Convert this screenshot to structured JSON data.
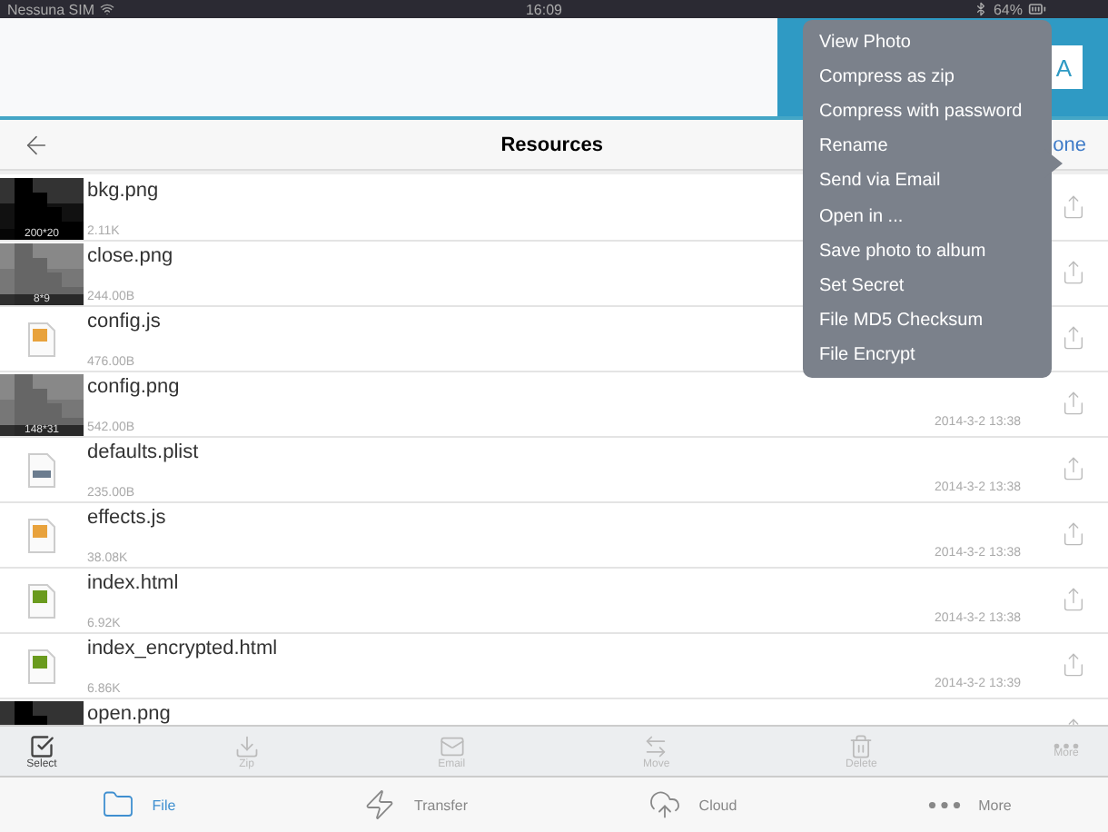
{
  "status_bar": {
    "carrier": "Nessuna SIM",
    "time": "16:09",
    "battery": "64%"
  },
  "header": {
    "button": "A"
  },
  "nav": {
    "title": "Resources",
    "action": "one"
  },
  "files": [
    {
      "name": "bkg.png",
      "size": "2.11K",
      "dims": "200*20"
    },
    {
      "name": "close.png",
      "size": "244.00B",
      "dims": "8*9"
    },
    {
      "name": "config.js",
      "size": "476.00B",
      "kind": "js"
    },
    {
      "name": "config.png",
      "size": "542.00B",
      "dims": "148*31",
      "date": "2014-3-2 13:38"
    },
    {
      "name": "defaults.plist",
      "size": "235.00B",
      "kind": "plist",
      "date": "2014-3-2 13:38"
    },
    {
      "name": "effects.js",
      "size": "38.08K",
      "kind": "js",
      "date": "2014-3-2 13:38"
    },
    {
      "name": "index.html",
      "size": "6.92K",
      "kind": "html",
      "date": "2014-3-2 13:38"
    },
    {
      "name": "index_encrypted.html",
      "size": "6.86K",
      "kind": "html",
      "date": "2014-3-2 13:39"
    },
    {
      "name": "open.png"
    }
  ],
  "toolbar": [
    {
      "label": "Select",
      "kind": "select",
      "disabled": false
    },
    {
      "label": "Zip",
      "kind": "zip",
      "disabled": true
    },
    {
      "label": "Email",
      "kind": "email",
      "disabled": true
    },
    {
      "label": "Move",
      "kind": "move",
      "disabled": true
    },
    {
      "label": "Delete",
      "kind": "delete",
      "disabled": true
    },
    {
      "label": "More",
      "kind": "more",
      "disabled": true
    }
  ],
  "tabs": [
    {
      "label": "File",
      "kind": "file",
      "selected": true
    },
    {
      "label": "Transfer",
      "kind": "transfer",
      "selected": false
    },
    {
      "label": "Cloud",
      "kind": "cloud",
      "selected": false
    },
    {
      "label": "More",
      "kind": "more",
      "selected": false
    }
  ],
  "menu": [
    "View Photo",
    "Compress as zip",
    "Compress with password",
    "Rename",
    "Send via Email",
    "Open in ...",
    "Save photo to album",
    "Set Secret",
    "File MD5 Checksum",
    "File Encrypt"
  ]
}
